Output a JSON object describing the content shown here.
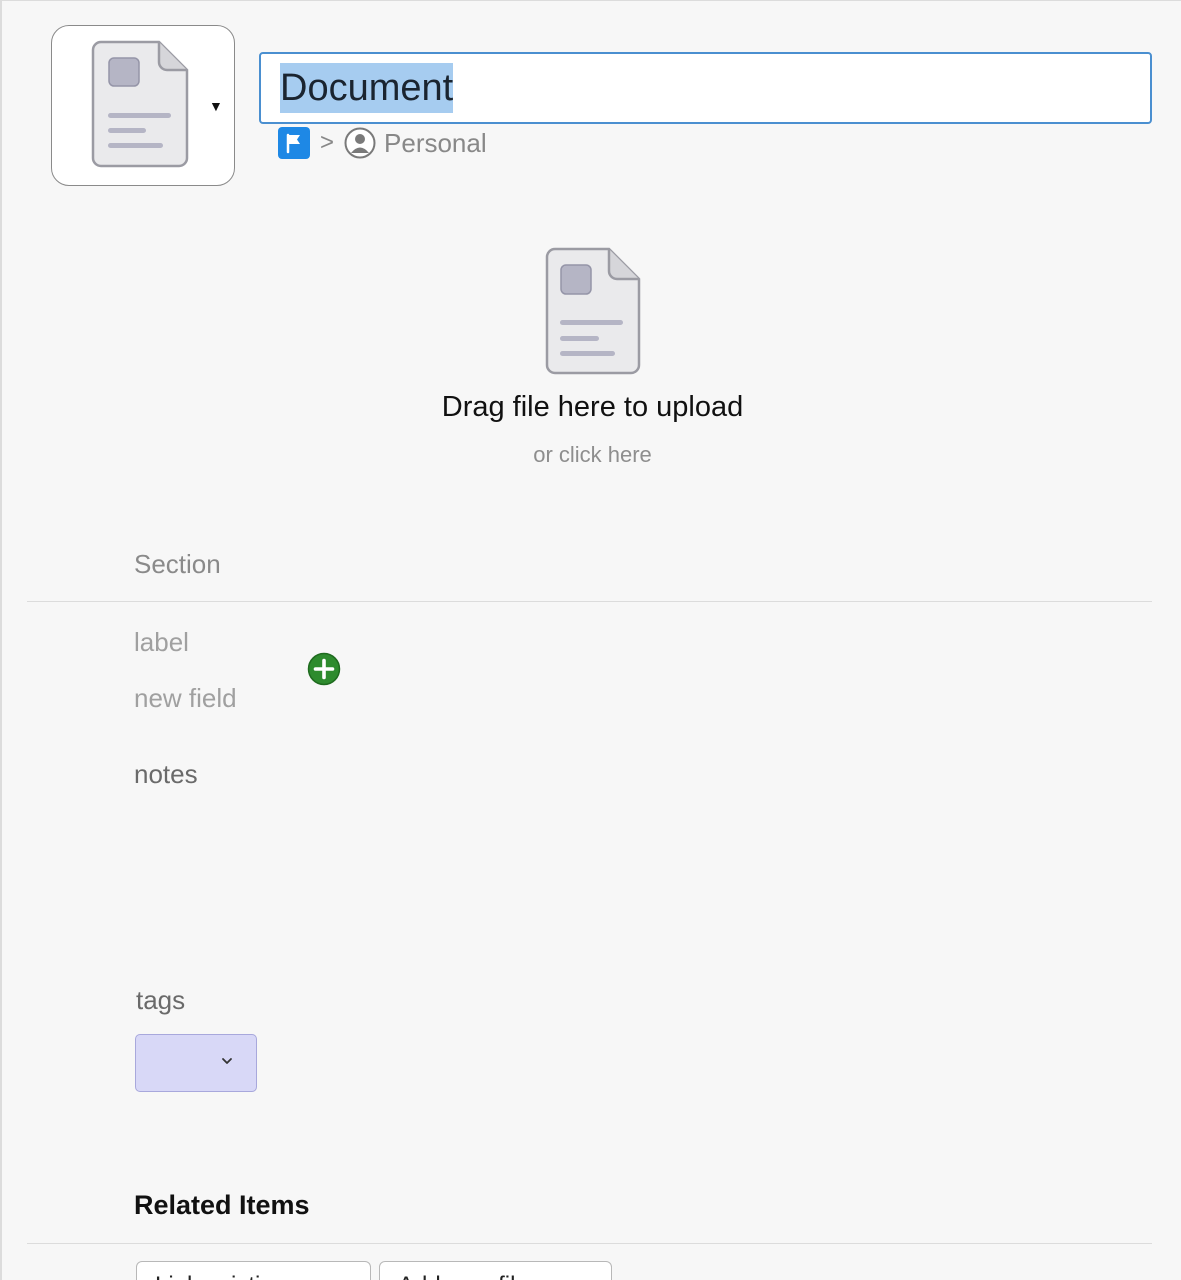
{
  "header": {
    "item_type_icon": "document-icon",
    "title_value": "Document",
    "breadcrumb": {
      "account_icon": "flag-icon",
      "separator": ">",
      "vault_icon": "person-icon",
      "vault_name": "Personal"
    }
  },
  "upload": {
    "icon": "document-icon",
    "main_text": "Drag file here to upload",
    "sub_text": "or click here"
  },
  "section": {
    "title": "Section",
    "label_placeholder": "label",
    "field_placeholder": "new field",
    "add_icon": "plus-circle-icon",
    "add_color": "#2e8b2e"
  },
  "notes": {
    "label": "notes"
  },
  "tags": {
    "label": "tags",
    "select_color": "#d8d8f7"
  },
  "related": {
    "title": "Related Items",
    "buttons": [
      "Link existing",
      "Add new file"
    ]
  },
  "colors": {
    "focus_border": "#4a8fd0",
    "selection": "#a6ccf0"
  }
}
